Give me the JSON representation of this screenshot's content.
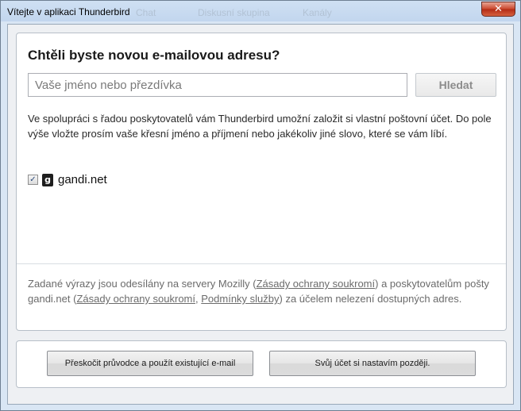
{
  "window": {
    "title": "Vítejte v aplikaci Thunderbird",
    "close_symbol": "✕",
    "background_ghost_tabs": [
      "Chat",
      "Diskusní skupina",
      "Kanály"
    ]
  },
  "main": {
    "heading": "Chtěli byste novou e-mailovou adresu?",
    "search": {
      "placeholder": "Vaše jméno nebo přezdívka",
      "value": "",
      "button_label": "Hledat"
    },
    "description": "Ve spolupráci s řadou poskytovatelů vám Thunderbird umožní založit si vlastní poštovní účet. Do pole výše vložte prosím vaše křesní jméno a příjmení nebo jakékoliv jiné slovo, které se vám líbí.",
    "providers": [
      {
        "name": "gandi.net",
        "checked": true,
        "icon": "gandi-logo-icon"
      }
    ],
    "privacy": {
      "text_1": "Zadané výrazy jsou odesílány na servery Mozilly (",
      "link_1": "Zásady ochrany soukromí",
      "text_2": ") a poskytovatelům pošty gandi.net (",
      "link_2": "Zásady ochrany soukromí",
      "text_3": ", ",
      "link_3": "Podmínky služby",
      "text_4": ") za účelem nelezení dostupných adres."
    }
  },
  "footer": {
    "skip_button": "Přeskočit průvodce a použít existující e-mail",
    "later_button": "Svůj účet si nastavím později."
  },
  "colors": {
    "titlebar": "#c2d6ee",
    "close_button": "#c9452b",
    "panel_background": "#ffffff"
  }
}
